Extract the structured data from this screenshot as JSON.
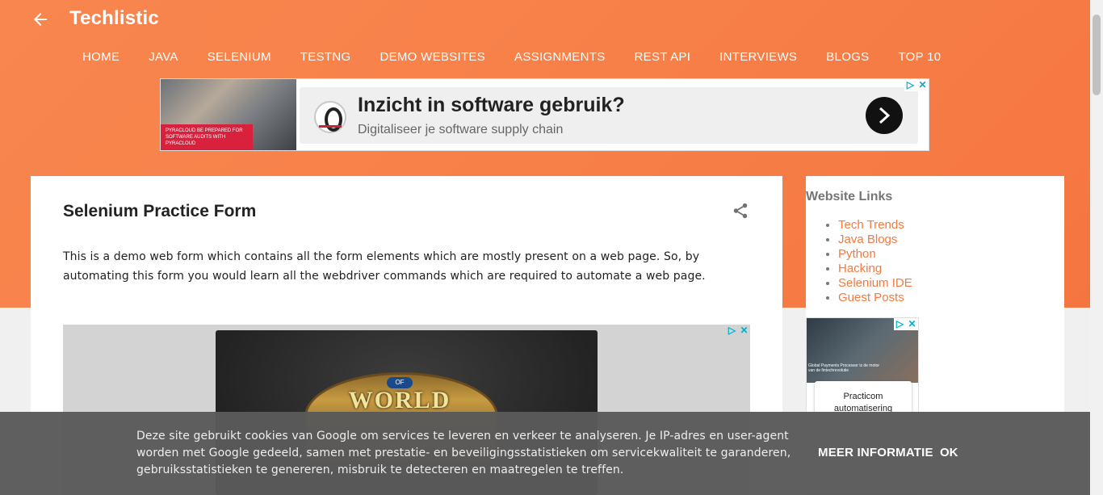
{
  "header": {
    "site_title": "Techlistic",
    "back_icon": "arrow-left-icon"
  },
  "nav": {
    "items": [
      "HOME",
      "JAVA",
      "SELENIUM",
      "TESTNG",
      "DEMO WEBSITES",
      "ASSIGNMENTS",
      "REST API",
      "INTERVIEWS",
      "BLOGS",
      "TOP 10"
    ]
  },
  "top_ad": {
    "image_caption": "PYRACLOUD BE PREPARED FOR SOFTWARE AUDITS WITH PYRACLOUD",
    "headline": "Inzicht in software gebruik?",
    "subline": "Digitaliseer je software supply chain",
    "adchoices_icon": "▷",
    "close_icon": "✕"
  },
  "post": {
    "title": "Selenium Practice Form",
    "body": "This is a demo web form which contains all the form elements which are mostly present on a web page. So, by automating this form you would learn all the webdriver commands which are required to automate a web page."
  },
  "mid_ad": {
    "game_title": "WORLD",
    "game_of": "OF",
    "adchoices_icon": "▷",
    "close_icon": "✕"
  },
  "sidebar": {
    "title": "Website Links",
    "links": [
      "Tech Trends",
      "Java Blogs",
      "Python",
      "Hacking",
      "Selenium IDE",
      "Guest Posts"
    ],
    "ad": {
      "photo_text": "Global Payments Processor is de motor van de fintechrevolutie",
      "card_text": "Practicom automatisering"
    }
  },
  "cookie": {
    "text": "Deze site gebruikt cookies van Google om services te leveren en verkeer te analyseren. Je IP-adres en user-agent worden met Google gedeeld, samen met prestatie- en beveiligingsstatistieken om servicekwaliteit te garanderen, gebruiksstatistieken te genereren, misbruik te detecteren en maatregelen te treffen.",
    "more_label": "MEER INFORMATIE",
    "ok_label": "OK"
  },
  "colors": {
    "header_orange": "#f78048",
    "link_orange": "#f37a40",
    "cookie_bg": "#5a5a5a"
  }
}
